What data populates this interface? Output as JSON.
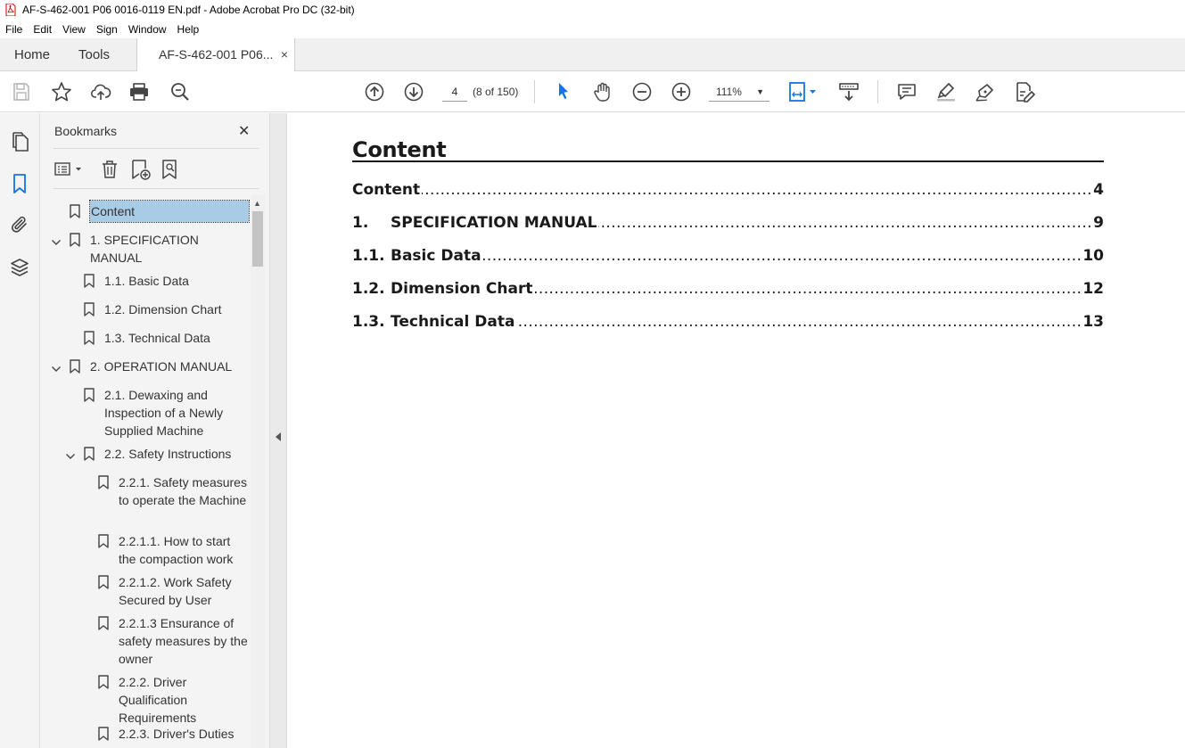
{
  "window": {
    "title": "AF-S-462-001 P06 0016-0119 EN.pdf - Adobe Acrobat Pro DC (32-bit)"
  },
  "menu": [
    "File",
    "Edit",
    "View",
    "Sign",
    "Window",
    "Help"
  ],
  "tabs": {
    "home": "Home",
    "tools": "Tools",
    "document": "AF-S-462-001 P06...",
    "close": "×"
  },
  "toolbar": {
    "page_value": "4",
    "page_count": "(8 of 150)",
    "zoom": "111%",
    "icons": [
      "save-icon",
      "bookmark-star-icon",
      "upload-cloud-icon",
      "print-icon",
      "search-zoom-icon",
      "prev-page-icon",
      "next-page-icon",
      "select-cursor-icon",
      "hand-icon",
      "zoom-out-icon",
      "zoom-in-icon",
      "page-fit-icon",
      "scroll-mode-icon",
      "comment-icon",
      "highlight-icon",
      "draw-icon",
      "edit-sign-icon"
    ]
  },
  "bookmarks": {
    "title": "Bookmarks",
    "close": "✕",
    "items": [
      {
        "label": "Content",
        "level": 0,
        "expandable": false,
        "selected": true
      },
      {
        "label": "1. SPECIFICATION MANUAL",
        "level": 0,
        "expandable": true
      },
      {
        "label": "1.1. Basic Data",
        "level": 1,
        "expandable": false
      },
      {
        "label": "1.2. Dimension Chart",
        "level": 1,
        "expandable": false
      },
      {
        "label": "1.3. Technical Data",
        "level": 1,
        "expandable": false
      },
      {
        "label": "2. OPERATION MANUAL",
        "level": 0,
        "expandable": true
      },
      {
        "label": "2.1. Dewaxing and Inspection of a Newly Supplied Machine",
        "level": 1,
        "expandable": false
      },
      {
        "label": "2.2. Safety Instructions",
        "level": 1,
        "expandable": true
      },
      {
        "label": "2.2.1. Safety measures to operate the Machine",
        "level": 2,
        "expandable": false
      },
      {
        "label": "2.2.1.1. How to start the compaction work",
        "level": 2,
        "expandable": false
      },
      {
        "label": "2.2.1.2. Work Safety Secured by User",
        "level": 2,
        "expandable": false
      },
      {
        "label": "2.2.1.3 Ensurance of safety measures by the owner",
        "level": 2,
        "expandable": false
      },
      {
        "label": "2.2.2. Driver Qualification Requirements",
        "level": 2,
        "expandable": false
      },
      {
        "label": "2.2.3. Driver's Duties",
        "level": 2,
        "expandable": false
      }
    ]
  },
  "document": {
    "heading": "Content",
    "toc": [
      {
        "num": "",
        "label": "Content",
        "page": "4"
      },
      {
        "num": "1.",
        "label": "SPECIFICATION MANUAL",
        "page": "9"
      },
      {
        "num": "1.1.",
        "label": "Basic Data",
        "page": "10"
      },
      {
        "num": "1.2.",
        "label": "Dimension Chart",
        "page": "12"
      },
      {
        "num": "1.3.",
        "label": "Technical Data",
        "page": "13"
      }
    ]
  },
  "colors": {
    "selection": "#a8cbe6",
    "icon_blue": "#1473e6",
    "panel_bg": "#f4f4f4"
  }
}
